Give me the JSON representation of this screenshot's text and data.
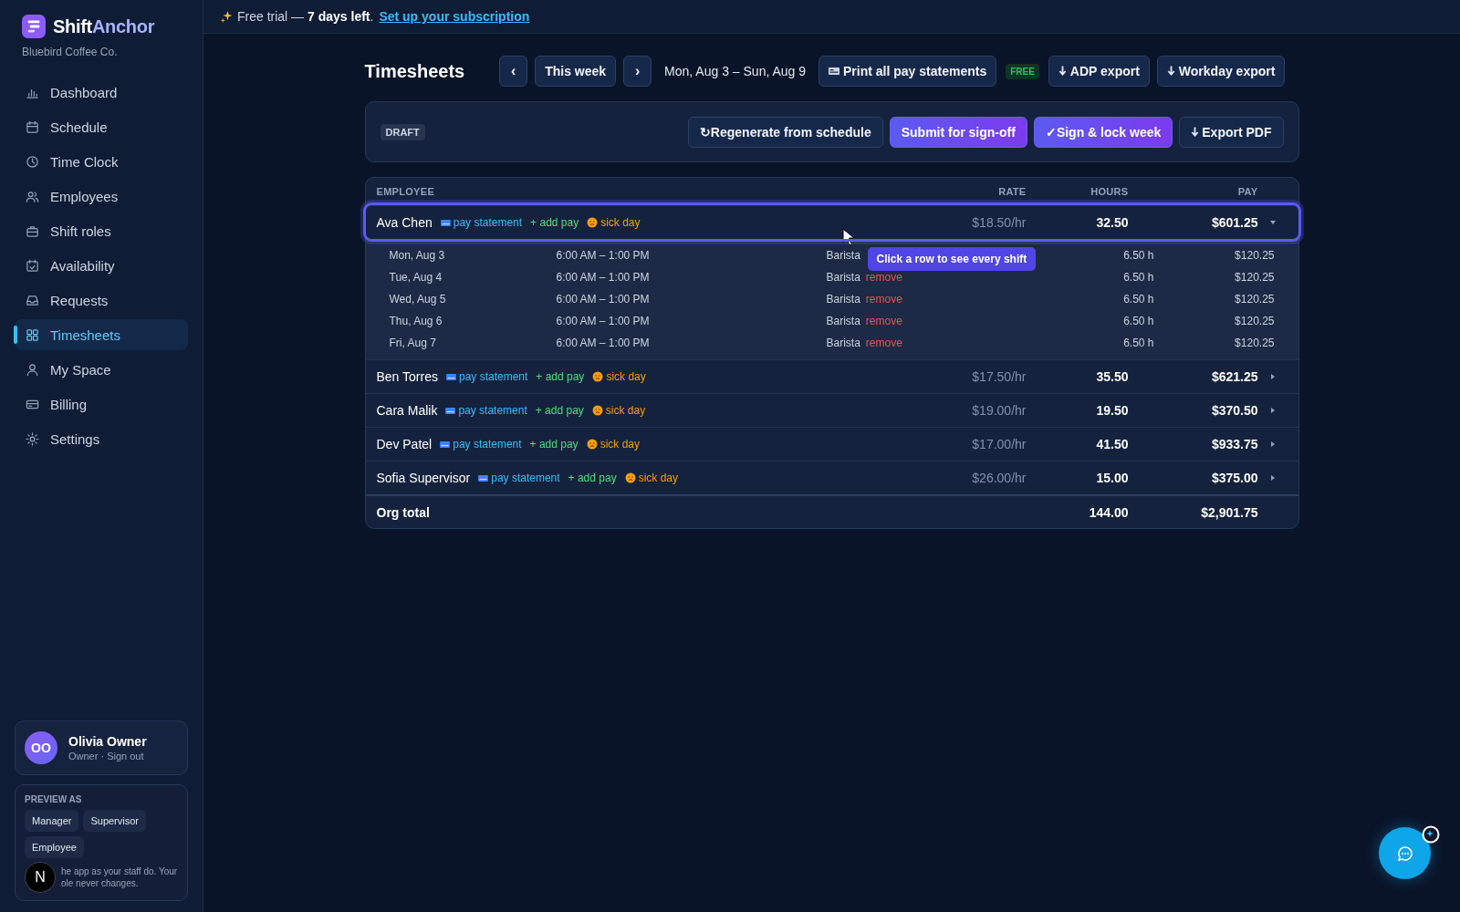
{
  "brand": {
    "name_first": "Shift",
    "name_second": "Anchor",
    "org": "Bluebird Coffee Co."
  },
  "sidebar": {
    "items": [
      {
        "label": "Dashboard",
        "selected": false
      },
      {
        "label": "Schedule",
        "selected": false
      },
      {
        "label": "Time Clock",
        "selected": false
      },
      {
        "label": "Employees",
        "selected": false
      },
      {
        "label": "Shift roles",
        "selected": false
      },
      {
        "label": "Availability",
        "selected": false
      },
      {
        "label": "Requests",
        "selected": false
      },
      {
        "label": "Timesheets",
        "selected": true
      },
      {
        "label": "My Space",
        "selected": false
      },
      {
        "label": "Billing",
        "selected": false
      },
      {
        "label": "Settings",
        "selected": false
      }
    ],
    "user": {
      "initials": "OO",
      "name": "Olivia Owner",
      "role": "Owner · Sign out"
    },
    "preview": {
      "title": "PREVIEW AS",
      "roles": [
        "Manager",
        "Supervisor",
        "Employee"
      ],
      "note": "he app as your staff do. Your ole never changes.",
      "badge": "N"
    }
  },
  "banner": {
    "text_before": "Free trial — ",
    "bold": "7 days left",
    "text_after": ".",
    "link": "Set up your subscription"
  },
  "header": {
    "title": "Timesheets",
    "prev": "‹",
    "week": "This week",
    "next": "›",
    "range": "Mon, Aug 3 – Sun, Aug 9",
    "print": "Print all pay statements",
    "free_badge": "FREE",
    "exports": [
      "ADP export",
      "Workday export"
    ]
  },
  "toolbar": {
    "status": "DRAFT",
    "buttons": [
      {
        "label": "↻Regenerate from schedule",
        "kind": "plain"
      },
      {
        "label": "Submit for sign-off",
        "kind": "primary"
      },
      {
        "label": "✓Sign & lock week",
        "kind": "primary"
      },
      {
        "label": "Export PDF",
        "kind": "download"
      }
    ]
  },
  "table": {
    "columns": [
      "EMPLOYEE",
      "RATE",
      "HOURS",
      "PAY"
    ],
    "rows": [
      {
        "name": "Ava Chen",
        "statement": "pay statement",
        "add": "+ add pay",
        "sick": "sick day",
        "rate": "$18.50/hr",
        "hours": "32.50",
        "pay": "$601.25",
        "expanded": true,
        "selected": true,
        "shifts": [
          {
            "date": "Mon, Aug 3",
            "time": "6:00 AM – 1:00 PM",
            "role": "Barista",
            "hours": "6.50 h",
            "pay": "$120.25"
          },
          {
            "date": "Tue, Aug 4",
            "time": "6:00 AM – 1:00 PM",
            "role": "Barista",
            "action": "remove",
            "hours": "6.50 h",
            "pay": "$120.25"
          },
          {
            "date": "Wed, Aug 5",
            "time": "6:00 AM – 1:00 PM",
            "role": "Barista",
            "action": "remove",
            "hours": "6.50 h",
            "pay": "$120.25"
          },
          {
            "date": "Thu, Aug 6",
            "time": "6:00 AM – 1:00 PM",
            "role": "Barista",
            "action": "remove",
            "hours": "6.50 h",
            "pay": "$120.25"
          },
          {
            "date": "Fri, Aug 7",
            "time": "6:00 AM – 1:00 PM",
            "role": "Barista",
            "action": "remove",
            "hours": "6.50 h",
            "pay": "$120.25"
          }
        ]
      },
      {
        "name": "Ben Torres",
        "statement": "pay statement",
        "add": "+ add pay",
        "sick": "sick day",
        "rate": "$17.50/hr",
        "hours": "35.50",
        "pay": "$621.25",
        "expanded": false,
        "selected": false
      },
      {
        "name": "Cara Malik",
        "statement": "pay statement",
        "add": "+ add pay",
        "sick": "sick day",
        "rate": "$19.00/hr",
        "hours": "19.50",
        "pay": "$370.50",
        "expanded": false,
        "selected": false
      },
      {
        "name": "Dev Patel",
        "statement": "pay statement",
        "add": "+ add pay",
        "sick": "sick day",
        "rate": "$17.00/hr",
        "hours": "41.50",
        "pay": "$933.75",
        "expanded": false,
        "selected": false
      },
      {
        "name": "Sofia Supervisor",
        "statement": "pay statement",
        "add": "+ add pay",
        "sick": "sick day",
        "rate": "$26.00/hr",
        "hours": "15.00",
        "pay": "$375.00",
        "expanded": false,
        "selected": false
      }
    ],
    "total": {
      "label": "Org total",
      "hours": "144.00",
      "pay": "$2,901.75"
    }
  },
  "tooltip": "Click a row to see every shift"
}
